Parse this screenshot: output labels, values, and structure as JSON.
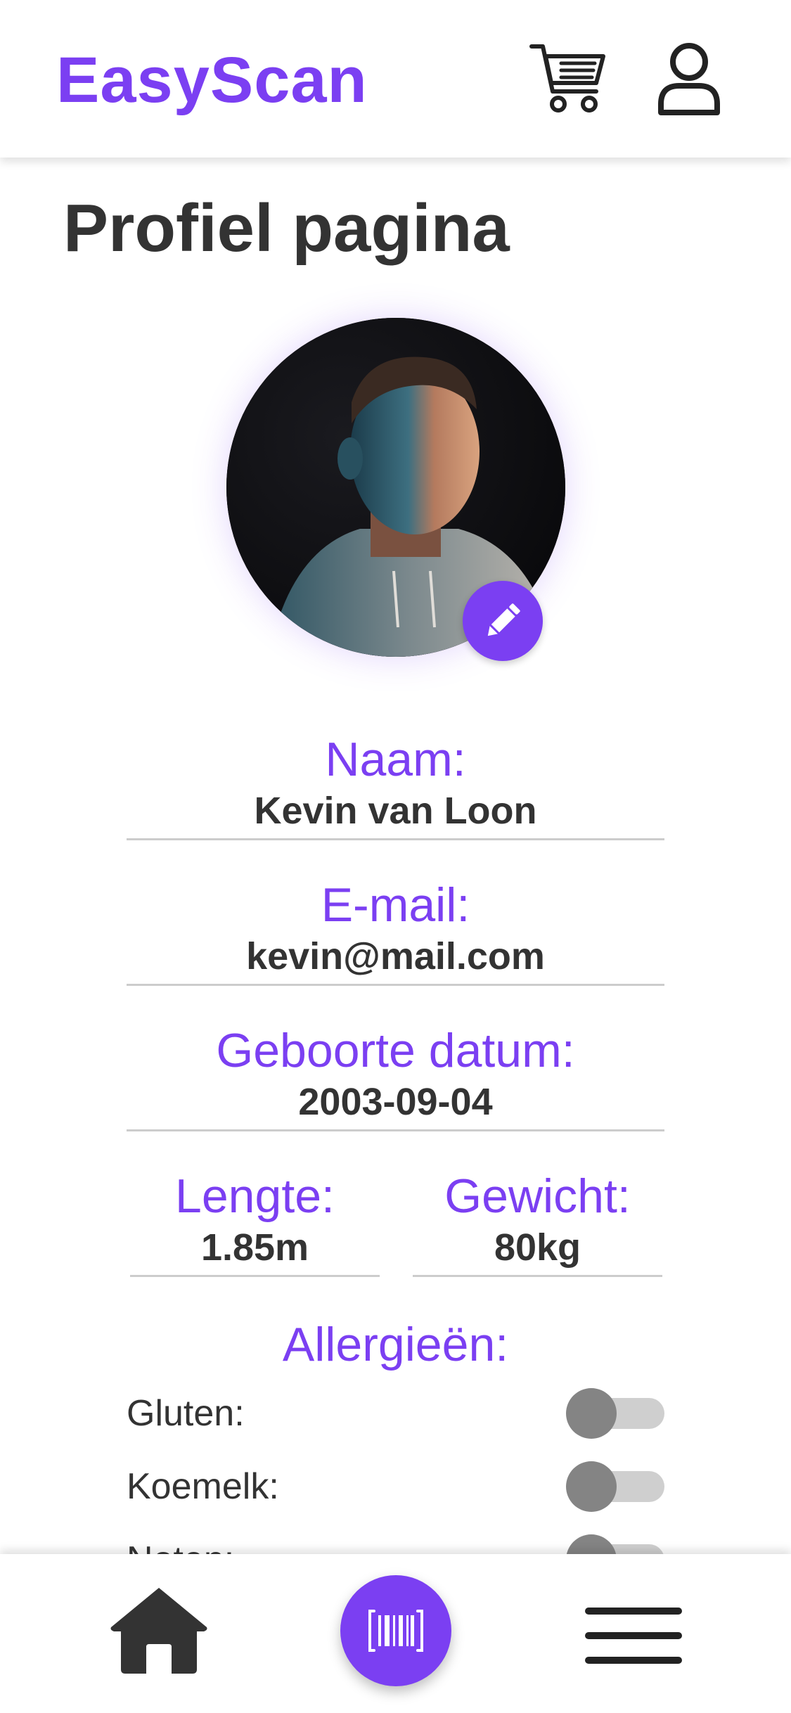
{
  "header": {
    "app_name": "EasyScan",
    "icons": {
      "cart": "shopping-cart-icon",
      "profile": "user-icon"
    }
  },
  "page": {
    "title": "Profiel pagina"
  },
  "profile": {
    "photo": "profile-photo",
    "edit_icon": "pencil-icon",
    "name": {
      "label": "Naam:",
      "value": "Kevin van Loon"
    },
    "email": {
      "label": "E-mail:",
      "value": "kevin@mail.com"
    },
    "birthdate": {
      "label": "Geboorte datum:",
      "value": "2003-09-04"
    },
    "height": {
      "label": "Lengte:",
      "value": "1.85m"
    },
    "weight": {
      "label": "Gewicht:",
      "value": "80kg"
    }
  },
  "allergies": {
    "title": "Allergieën:",
    "items": [
      {
        "label": "Gluten:",
        "enabled": false
      },
      {
        "label": "Koemelk:",
        "enabled": false
      },
      {
        "label": "Noten:",
        "enabled": false
      }
    ]
  },
  "bottom_nav": {
    "home_icon": "home-icon",
    "scan_icon": "barcode-scan-icon",
    "menu_icon": "hamburger-menu-icon"
  },
  "colors": {
    "accent": "#7b3ff2",
    "text": "#333333",
    "divider": "#cccccc",
    "toggle_off_track": "#cfcfcf",
    "toggle_off_knob": "#848484"
  }
}
